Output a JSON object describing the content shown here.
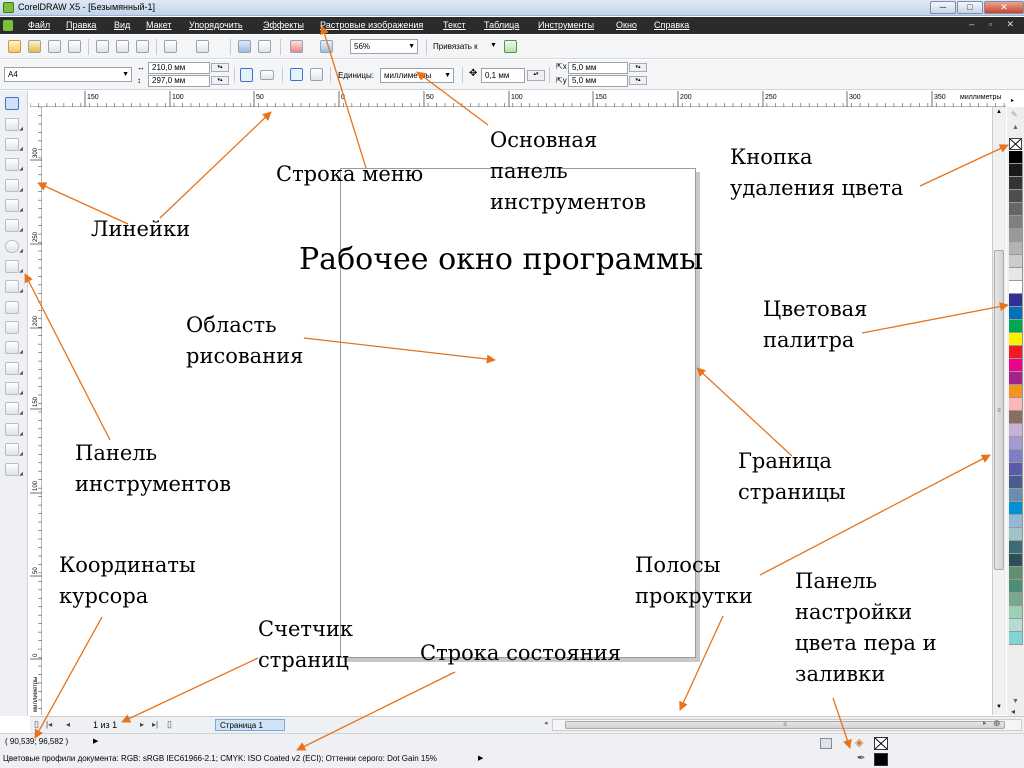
{
  "window": {
    "title": "CorelDRAW X5 - [Безымянный-1]",
    "controls": {
      "minimize": "─",
      "maximize": "□",
      "close": "✕"
    },
    "mdi_controls": "– ▫ ✕"
  },
  "menu": [
    "Файл",
    "Правка",
    "Вид",
    "Макет",
    "Упорядочить",
    "Эффекты",
    "Растровые изображения",
    "Текст",
    "Таблица",
    "Инструменты",
    "Окно",
    "Справка"
  ],
  "toolbar": {
    "zoom": "56%",
    "snap_label": "Привязать к"
  },
  "propbar": {
    "paper_size": "A4",
    "width": "210,0 мм",
    "height": "297,0 мм",
    "units_label": "Единицы:",
    "units_value": "миллиметры",
    "nudge": "0,1 мм",
    "dup_x": "5,0 мм",
    "dup_y": "5,0 мм"
  },
  "ruler": {
    "unit": "миллиметры",
    "top_ticks": [
      "150",
      "100",
      "50",
      "0",
      "50",
      "100",
      "150",
      "200",
      "250",
      "300",
      "350"
    ],
    "left_ticks": [
      "300",
      "250",
      "200",
      "150",
      "100",
      "50",
      "0"
    ],
    "left_unit": "миллиметры"
  },
  "page_nav": {
    "counter": "1 из 1",
    "tab": "Страница 1"
  },
  "status": {
    "coords": "( 90,539; 96,582 )",
    "profiles": "Цветовые профили документа: RGB: sRGB IEC61966-2.1; CMYK: ISO Coated v2 (ECI); Оттенки серого: Dot Gain 15%"
  },
  "palette": [
    "#000000",
    "#1a1a1a",
    "#333333",
    "#4d4d4d",
    "#666666",
    "#808080",
    "#999999",
    "#b3b3b3",
    "#cccccc",
    "#e6e6e6",
    "#ffffff",
    "#2e3192",
    "#0072bc",
    "#00a651",
    "#fff200",
    "#ed1c24",
    "#ec008c",
    "#a3238e",
    "#f7941d",
    "#f9b7b7",
    "#8c6d62",
    "#c7b2d6",
    "#a59ad0",
    "#7f7fc5",
    "#5a5aa8",
    "#4c5c8a",
    "#6a8caf",
    "#0091d2",
    "#8fb9d6",
    "#a0c4c8",
    "#3b6b75",
    "#2f4f57",
    "#5f8f6f",
    "#4d8c77",
    "#77a88a",
    "#9ccfb5",
    "#b6dbd0",
    "#7fd6d4"
  ],
  "annotations": {
    "menu_line": "Строка меню",
    "main_toolbar": "Основная\nпанель\nинструментов",
    "delete_color": "Кнопка\nудаления цвета",
    "rulers": "Линейки",
    "workspace": "Рабочее окно программы",
    "drawing_area": "Область\nрисования",
    "color_palette": "Цветовая\nпалитра",
    "toolbox": "Панель\nинструментов",
    "page_border": "Граница\nстраницы",
    "cursor_coords": "Координаты\nкурсора",
    "scrollbars": "Полосы\nпрокрутки",
    "pen_fill_panel": "Панель\nнастройки\nцвета пера и\nзаливки",
    "page_counter": "Счетчик\nстраниц",
    "status_line": "Строка состояния"
  }
}
